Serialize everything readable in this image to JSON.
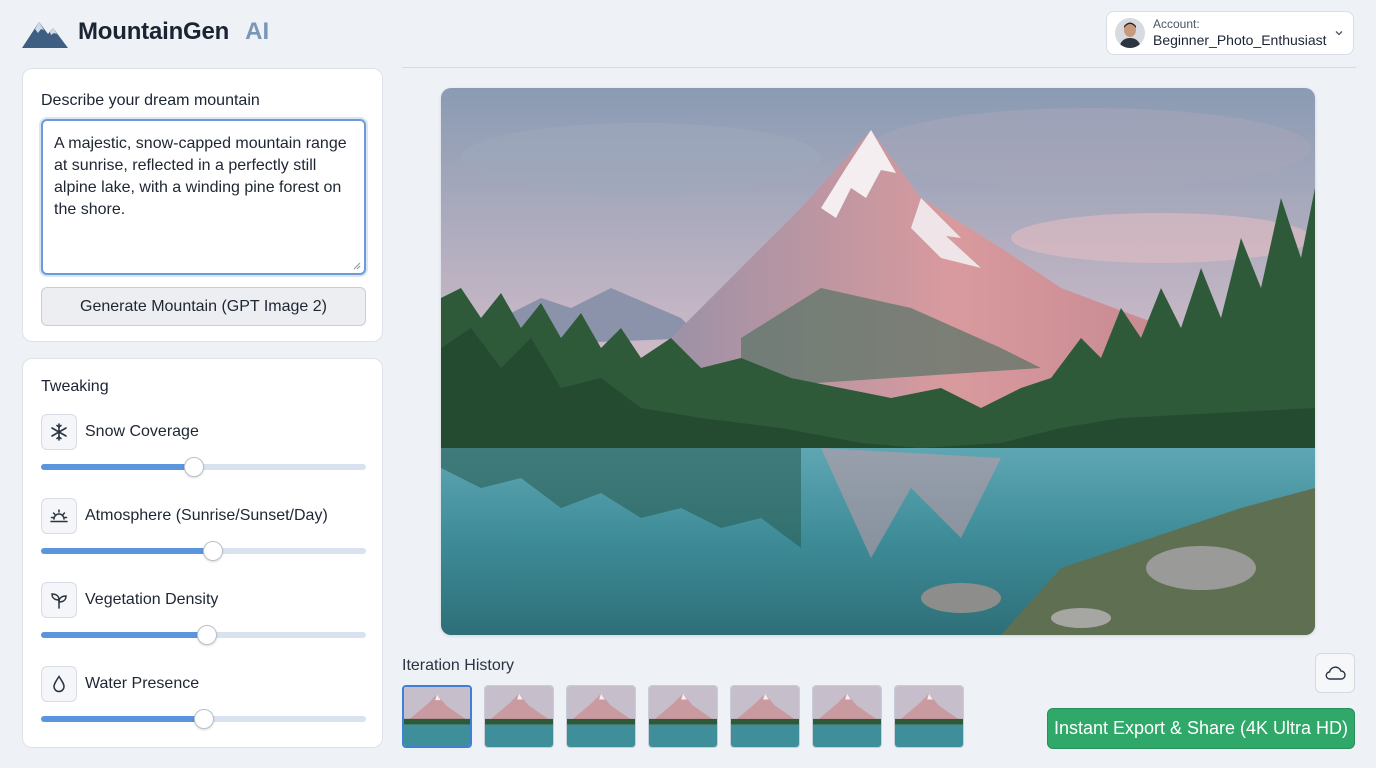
{
  "app": {
    "name": "MountainGen",
    "name_suffix": "AI"
  },
  "account": {
    "label": "Account:",
    "username": "Beginner_Photo_Enthusiast"
  },
  "prompt": {
    "title": "Describe your dream mountain",
    "value": "A majestic, snow-capped mountain range at sunrise, reflected in a perfectly still alpine lake, with a winding pine forest on the shore.",
    "generate_label": "Generate Mountain (GPT Image 2)"
  },
  "tweaking": {
    "title": "Tweaking",
    "sliders": [
      {
        "label": "Snow Coverage",
        "icon": "snowflake-icon",
        "value": 0.47
      },
      {
        "label": "Atmosphere (Sunrise/Sunset/Day)",
        "icon": "sunrise-icon",
        "value": 0.53
      },
      {
        "label": "Vegetation Density",
        "icon": "sprout-icon",
        "value": 0.51
      },
      {
        "label": "Water Presence",
        "icon": "water-drop-icon",
        "value": 0.5
      }
    ]
  },
  "history": {
    "title": "Iteration History",
    "count": 7,
    "active_index": 0
  },
  "actions": {
    "export_label": "Instant Export & Share (4K Ultra HD)",
    "cloud_icon": "cloud-icon"
  },
  "colors": {
    "accent": "#5b95dd",
    "export": "#2fa86a",
    "brand_ai": "#7a97b8"
  }
}
